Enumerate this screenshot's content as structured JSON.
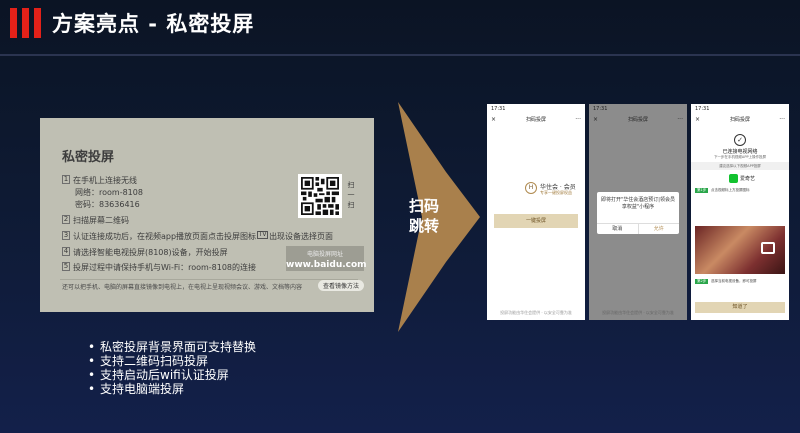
{
  "header": {
    "title": "方案亮点 - 私密投屏"
  },
  "card": {
    "title": "私密投屏",
    "step1": {
      "num": "1",
      "text": "在手机上连接无线",
      "network": "网络：room-8108",
      "password": "密码：83636416"
    },
    "step2": {
      "num": "2",
      "text": "扫描屏幕二维码"
    },
    "step3": {
      "num": "3",
      "text_before": "认证连接成功后，在视频app播放页面点击投屏图标",
      "icon_label": "TV",
      "text_after": "出现设备选择页面"
    },
    "step4": {
      "num": "4",
      "text": "请选择智能电视投屏(8108)设备，开始投屏"
    },
    "step5": {
      "num": "5",
      "text": "投屏过程中请保持手机与Wi-Fi：room-8108的连接"
    },
    "scan_label": "扫一扫",
    "pc": {
      "label": "电脑投屏网址",
      "url": "www.baidu.com"
    },
    "footnote": "还可以把手机、电脑的屏幕直接镜像到电视上，在电视上呈现视频会议、游戏、文档等内容",
    "mirror_button": "查看镜像方法"
  },
  "arrow": {
    "text": "扫码跳转"
  },
  "phone1": {
    "time": "17:31",
    "title": "扫码投屏",
    "close": "×",
    "menu": "···",
    "brand": "华住会 · 会员",
    "brand_sub": "专享一键投屏权益",
    "logo_char": "H",
    "button": "一键投屏",
    "footer": "投屏功能由华住会提供 · 以安全可靠为准"
  },
  "phone2": {
    "time": "17:31",
    "title": "扫码投屏",
    "close": "×",
    "menu": "···",
    "dialog_message": "即将打开\"华住会酒店预订|领会员享权益\"小程序",
    "cancel": "取消",
    "allow": "允许",
    "footer": "投屏功能由华住会提供 · 以安全可靠为准"
  },
  "phone3": {
    "time": "17:31",
    "title": "扫码投屏",
    "close": "×",
    "menu": "···",
    "check": "✓",
    "connected_title": "已连接电视网络",
    "connected_sub": "下一步在手机视频APP上操作投屏",
    "section_label": "建议选择以下视频APP投屏",
    "app_name": "爱奇艺",
    "step1_tag": "第1步",
    "step1_text": "点击视频标上方投屏图标",
    "step2_tag": "第2步",
    "step2_text": "选择当前电视设备，即可投屏",
    "ok_button": "知道了"
  },
  "bullets": [
    "私密投屏背景界面可支持替换",
    "支持二维码扫码投屏",
    "支持启动后wifi认证投屏",
    "支持电脑端投屏"
  ],
  "colors": {
    "accent_red": "#e32119",
    "arrow_gold": "#a9804c",
    "card_gray": "#bfbfb3"
  }
}
